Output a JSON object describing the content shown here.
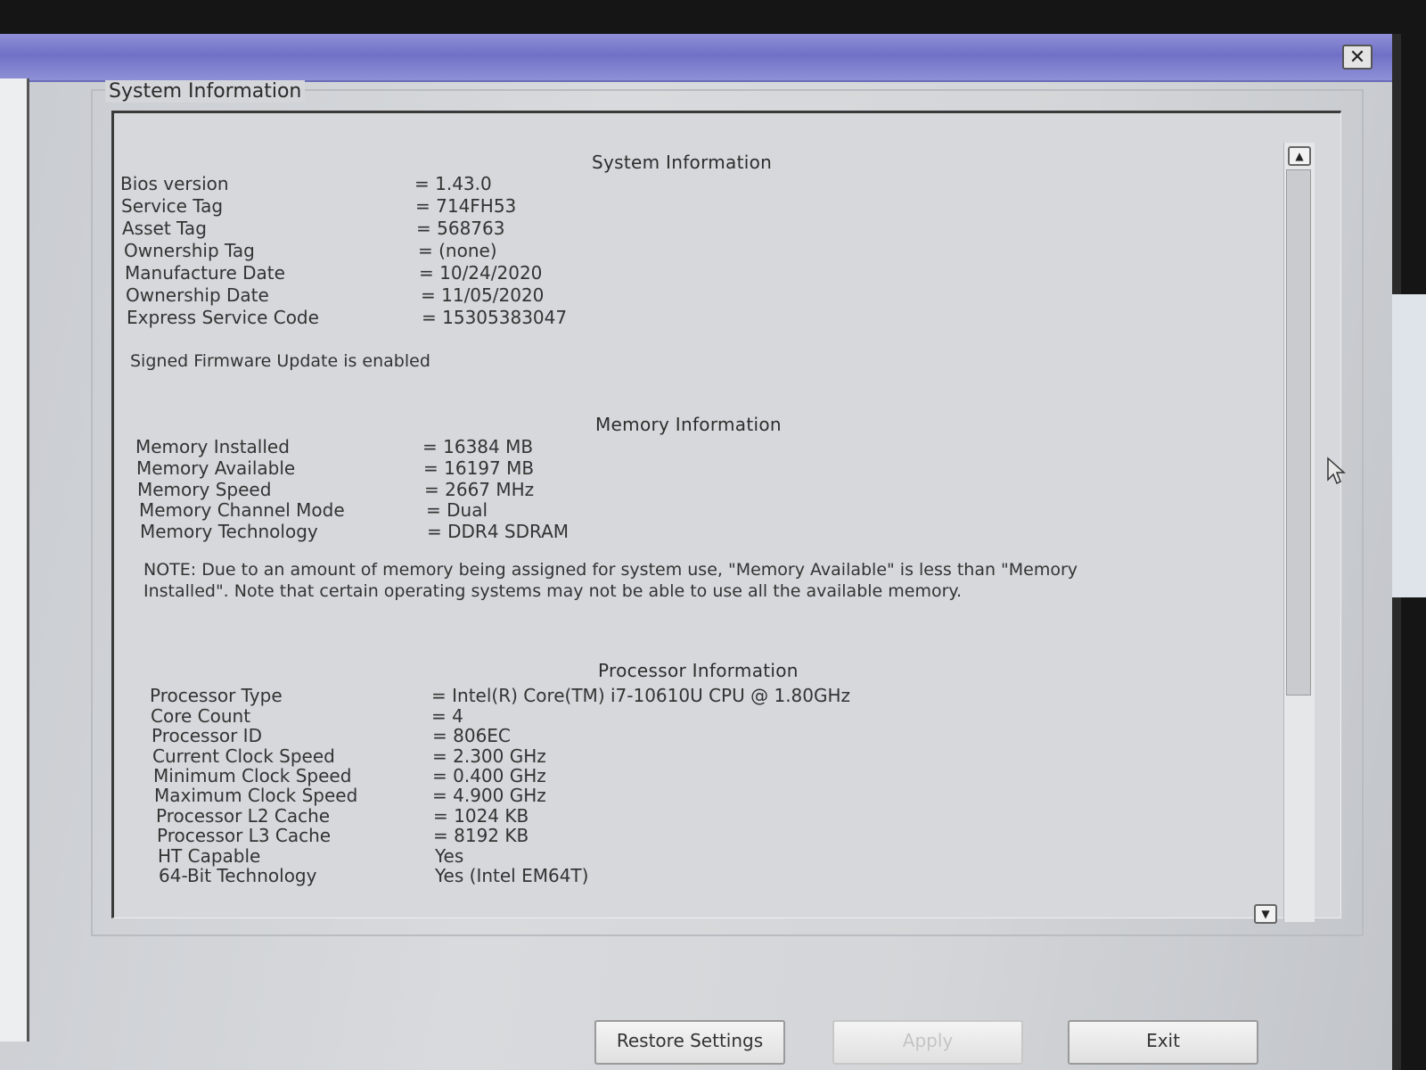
{
  "window": {
    "close_glyph": "✕"
  },
  "group": {
    "legend": "System Information"
  },
  "system": {
    "title": "System Information",
    "rows": [
      {
        "label": "Bios version",
        "value": "= 1.43.0"
      },
      {
        "label": "Service Tag",
        "value": "= 714FH53"
      },
      {
        "label": "Asset Tag",
        "value": "= 568763"
      },
      {
        "label": "Ownership Tag",
        "value": "= (none)"
      },
      {
        "label": "Manufacture Date",
        "value": "= 10/24/2020"
      },
      {
        "label": "Ownership Date",
        "value": "= 11/05/2020"
      },
      {
        "label": "Express Service Code",
        "value": "= 15305383047"
      }
    ],
    "firmware_note": "Signed Firmware Update is enabled"
  },
  "memory": {
    "title": "Memory Information",
    "rows": [
      {
        "label": "Memory Installed",
        "value": "= 16384 MB"
      },
      {
        "label": "Memory Available",
        "value": "= 16197 MB"
      },
      {
        "label": "Memory Speed",
        "value": "= 2667 MHz"
      },
      {
        "label": "Memory Channel Mode",
        "value": "= Dual"
      },
      {
        "label": "Memory Technology",
        "value": "= DDR4 SDRAM"
      }
    ],
    "note": "NOTE: Due to an amount of memory being assigned for system use, \"Memory Available\" is less than \"Memory Installed\". Note that certain operating systems may not be able to use all the available memory."
  },
  "processor": {
    "title": "Processor Information",
    "rows": [
      {
        "label": "Processor Type",
        "value": "= Intel(R) Core(TM) i7-10610U CPU @ 1.80GHz"
      },
      {
        "label": "Core Count",
        "value": "= 4"
      },
      {
        "label": "Processor ID",
        "value": "= 806EC"
      },
      {
        "label": "Current Clock Speed",
        "value": "= 2.300 GHz"
      },
      {
        "label": "Minimum Clock Speed",
        "value": "= 0.400 GHz"
      },
      {
        "label": "Maximum Clock Speed",
        "value": "= 4.900 GHz"
      },
      {
        "label": "Processor L2 Cache",
        "value": "= 1024 KB"
      },
      {
        "label": "Processor L3 Cache",
        "value": "= 8192 KB"
      },
      {
        "label": "HT Capable",
        "value": "Yes"
      },
      {
        "label": "64-Bit Technology",
        "value": "Yes (Intel EM64T)"
      }
    ]
  },
  "buttons": {
    "restore": "Restore Settings",
    "apply": "Apply",
    "exit": "Exit"
  },
  "scrollbar": {
    "up_glyph": "▲",
    "down_glyph": "▼"
  }
}
